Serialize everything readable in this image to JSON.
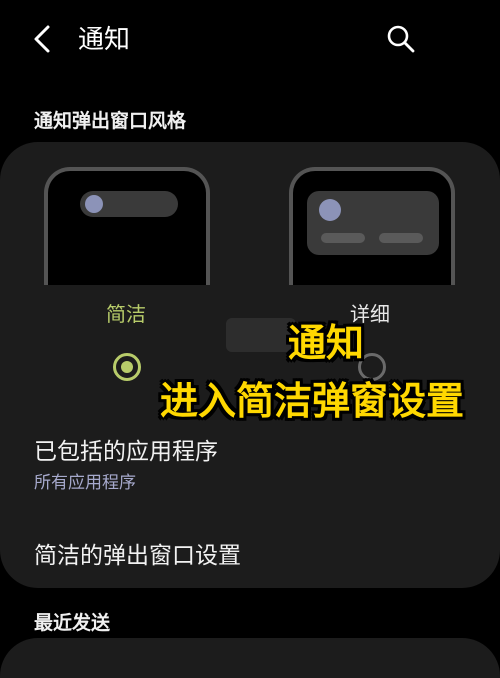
{
  "header": {
    "title": "通知",
    "back_icon": "back-arrow-icon",
    "search_icon": "search-icon"
  },
  "popup_style": {
    "section_title": "通知弹出窗口风格",
    "options": [
      {
        "label": "简洁",
        "selected": true
      },
      {
        "label": "详细",
        "selected": false
      }
    ],
    "accent_color": "#b8cc6a"
  },
  "included_apps": {
    "title": "已包括的应用程序",
    "subtitle": "所有应用程序"
  },
  "brief_settings": {
    "title": "简洁的弹出窗口设置"
  },
  "recent": {
    "section_title": "最近发送"
  },
  "overlay_caption": {
    "line1": "通知",
    "line2": "进入简洁弹窗设置",
    "color": "#ffd800"
  }
}
